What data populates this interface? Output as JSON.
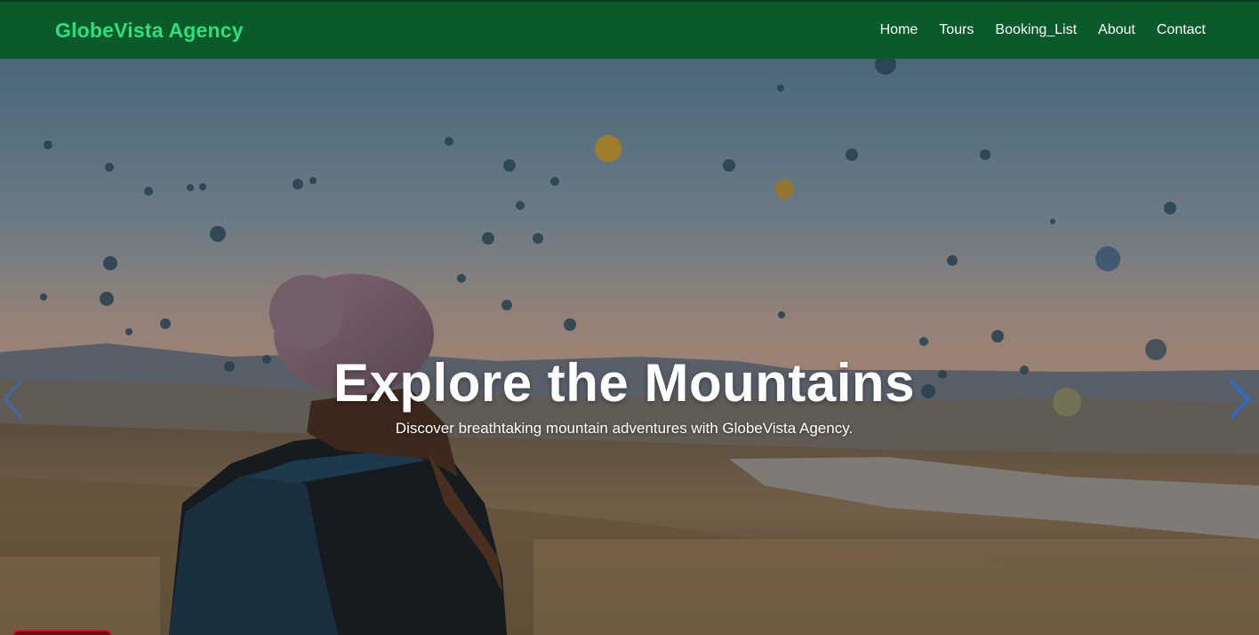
{
  "navbar": {
    "brand": "GlobeVista Agency",
    "links": [
      "Home",
      "Tours",
      "Booking_List",
      "About",
      "Contact"
    ]
  },
  "hero": {
    "title": "Explore the Mountains",
    "subtitle": "Discover breathtaking mountain adventures with GlobeVista Agency.",
    "prev_icon": "chevron-left-icon",
    "next_icon": "chevron-right-icon"
  },
  "colors": {
    "navbar_bg": "#0b5a2c",
    "brand_text": "#2ee07c",
    "arrow_next": "#1e6fe0",
    "arrow_prev": "#3b6aa8"
  }
}
